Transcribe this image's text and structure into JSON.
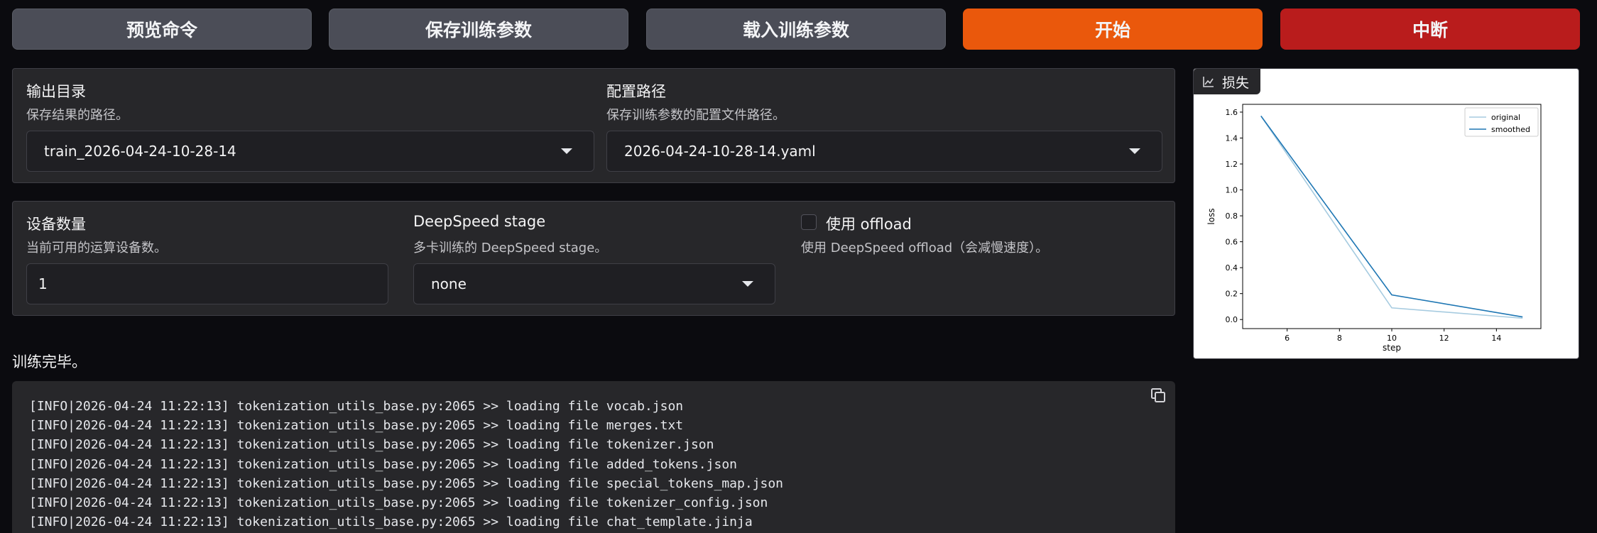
{
  "buttons": {
    "preview": "预览命令",
    "save": "保存训练参数",
    "load": "载入训练参数",
    "start": "开始",
    "abort": "中断"
  },
  "output_dir": {
    "label": "输出目录",
    "info": "保存结果的路径。",
    "value": "train_2026-04-24-10-28-14"
  },
  "config_path": {
    "label": "配置路径",
    "info": "保存训练参数的配置文件路径。",
    "value": "2026-04-24-10-28-14.yaml"
  },
  "device_count": {
    "label": "设备数量",
    "info": "当前可用的运算设备数。",
    "value": "1"
  },
  "ds_stage": {
    "label": "DeepSpeed stage",
    "info": "多卡训练的 DeepSpeed stage。",
    "value": "none"
  },
  "ds_offload": {
    "label": "使用 offload",
    "info": "使用 DeepSpeed offload（会减慢速度）。",
    "checked": false
  },
  "status": "训练完毕。",
  "log_lines": [
    "[INFO|2026-04-24 11:22:13] tokenization_utils_base.py:2065 >> loading file vocab.json",
    "[INFO|2026-04-24 11:22:13] tokenization_utils_base.py:2065 >> loading file merges.txt",
    "[INFO|2026-04-24 11:22:13] tokenization_utils_base.py:2065 >> loading file tokenizer.json",
    "[INFO|2026-04-24 11:22:13] tokenization_utils_base.py:2065 >> loading file added_tokens.json",
    "[INFO|2026-04-24 11:22:13] tokenization_utils_base.py:2065 >> loading file special_tokens_map.json",
    "[INFO|2026-04-24 11:22:13] tokenization_utils_base.py:2065 >> loading file tokenizer_config.json",
    "[INFO|2026-04-24 11:22:13] tokenization_utils_base.py:2065 >> loading file chat_template.jinja"
  ],
  "plot_label": "损失",
  "icons": {
    "dropdown": "chevron-down-icon",
    "copy": "copy-icon",
    "plot": "line-chart-icon"
  },
  "colors": {
    "start": "#ea580c",
    "abort": "#b91c1c",
    "original": "#a6cbe0",
    "smoothed": "#1f77b4"
  },
  "chart_data": {
    "type": "line",
    "title": "",
    "xlabel": "step",
    "ylabel": "loss",
    "xlim": [
      4.3,
      15.7
    ],
    "ylim": [
      -0.07,
      1.66
    ],
    "xticks": [
      6,
      8,
      10,
      12,
      14
    ],
    "yticks": [
      0.0,
      0.2,
      0.4,
      0.6,
      0.8,
      1.0,
      1.2,
      1.4,
      1.6
    ],
    "legend_position": "top-right",
    "series": [
      {
        "name": "original",
        "x": [
          5,
          10,
          15
        ],
        "y": [
          1.57,
          0.09,
          0.01
        ],
        "color": "#a6cbe0"
      },
      {
        "name": "smoothed",
        "x": [
          5,
          10,
          15
        ],
        "y": [
          1.57,
          0.19,
          0.02
        ],
        "color": "#1f77b4"
      }
    ]
  }
}
